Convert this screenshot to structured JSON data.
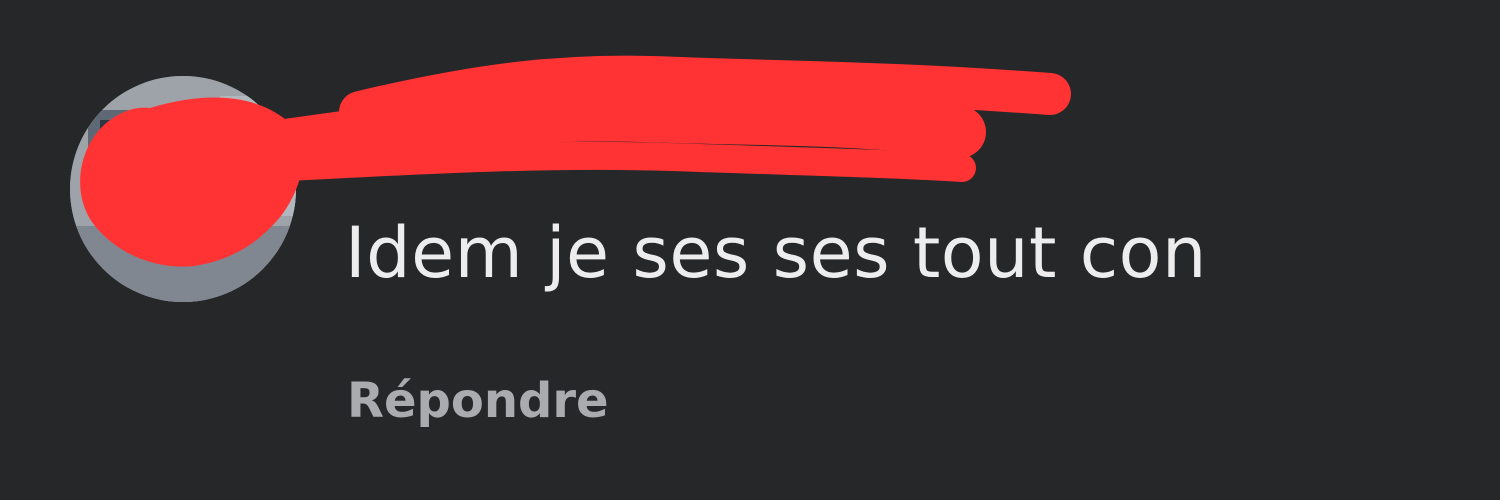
{
  "comment": {
    "author_name": "",
    "text": "Idem je ses ses tout con",
    "reply_label": "Répondre"
  },
  "colors": {
    "background": "#262729",
    "text": "#ededee",
    "reply_text": "#a9abae",
    "redaction": "#ff3333"
  },
  "icons": {
    "avatar": "profile-photo"
  }
}
